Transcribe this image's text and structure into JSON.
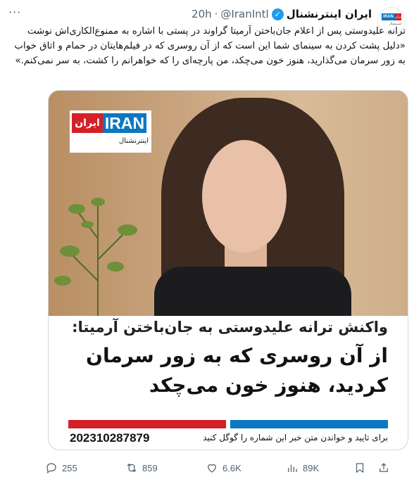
{
  "header": {
    "name": "ایران اینترنشنال",
    "handle": "@IranIntl",
    "separator": "·",
    "time": "20h",
    "more": "···"
  },
  "avatar": {
    "brand": "IRAN",
    "brand_ar": "ایران",
    "sub": "اینترنشنال"
  },
  "tweet": {
    "text": "ترانه علیدوستی پس از اعلام جان‌باختن آرمیتا گراوند در پستی با اشاره به ممنوع‌الکاری‌اش نوشت «دلیل پشت کردن به سینمای شما این است که از آن روسری که در فیلم‌هایتان در حمام و اتاق خواب به زور سرمان می‌گذارید، هنوز خون می‌چکد، من پارچه‌ای را که خواهرانم را کشت، به سر نمی‌کنم.»"
  },
  "media": {
    "logo_main": "IRAN",
    "logo_ar": "ایران",
    "logo_sub": "اینترنشنال",
    "caption_line1": "واکنش ترانه علیدوستی به جان‌باختن آرمیتا:",
    "caption_line2": "از آن روسری که به زور سرمان کردید، هنوز خون می‌چکد",
    "number": "202310287879",
    "note": "برای تایید و خواندن متن خبر این شماره را گوگل کنید"
  },
  "colors": {
    "verified": "#1d9bf0",
    "brand_blue": "#0b78c2",
    "brand_red": "#d42027",
    "muted": "#536471"
  },
  "actions": {
    "replies": "255",
    "reposts": "859",
    "likes": "6.6K",
    "views": "89K",
    "icons": [
      "reply-icon",
      "repost-icon",
      "like-icon",
      "views-icon",
      "bookmark-icon",
      "share-icon"
    ]
  }
}
